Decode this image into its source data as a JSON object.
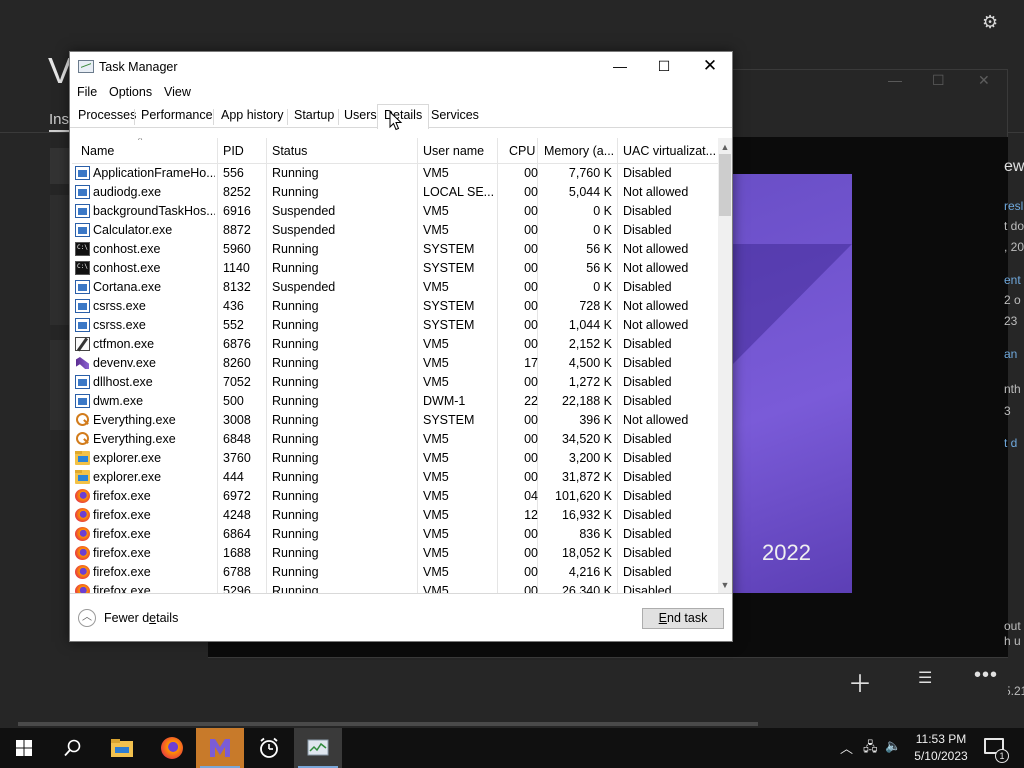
{
  "background_app": {
    "title_fragment": "V",
    "tab_fragment": "Ins",
    "year": "2022",
    "side_texts": [
      "ew",
      "resl",
      "t do",
      ", 20",
      "ent",
      "2 o",
      "23",
      "an",
      "nth",
      "3",
      "t d",
      "out",
      "h u",
      "5.21"
    ]
  },
  "task_manager": {
    "title": "Task Manager",
    "menu": [
      "File",
      "Options",
      "View"
    ],
    "tabs": [
      "Processes",
      "Performance",
      "App history",
      "Startup",
      "Users",
      "Details",
      "Services"
    ],
    "active_tab": "Details",
    "columns": [
      "Name",
      "PID",
      "Status",
      "User name",
      "CPU",
      "Memory (a...",
      "UAC virtualizat..."
    ],
    "rows": [
      {
        "icon": "app-icon",
        "name": "ApplicationFrameHo...",
        "pid": "556",
        "status": "Running",
        "user": "VM5",
        "cpu": "00",
        "mem": "7,760 K",
        "uac": "Disabled"
      },
      {
        "icon": "app-icon",
        "name": "audiodg.exe",
        "pid": "8252",
        "status": "Running",
        "user": "LOCAL SE...",
        "cpu": "00",
        "mem": "5,044 K",
        "uac": "Not allowed"
      },
      {
        "icon": "app-icon",
        "name": "backgroundTaskHos...",
        "pid": "6916",
        "status": "Suspended",
        "user": "VM5",
        "cpu": "00",
        "mem": "0 K",
        "uac": "Disabled"
      },
      {
        "icon": "app-icon",
        "name": "Calculator.exe",
        "pid": "8872",
        "status": "Suspended",
        "user": "VM5",
        "cpu": "00",
        "mem": "0 K",
        "uac": "Disabled"
      },
      {
        "icon": "console-icon",
        "name": "conhost.exe",
        "pid": "5960",
        "status": "Running",
        "user": "SYSTEM",
        "cpu": "00",
        "mem": "56 K",
        "uac": "Not allowed"
      },
      {
        "icon": "console-icon",
        "name": "conhost.exe",
        "pid": "1140",
        "status": "Running",
        "user": "SYSTEM",
        "cpu": "00",
        "mem": "56 K",
        "uac": "Not allowed"
      },
      {
        "icon": "app-icon",
        "name": "Cortana.exe",
        "pid": "8132",
        "status": "Suspended",
        "user": "VM5",
        "cpu": "00",
        "mem": "0 K",
        "uac": "Disabled"
      },
      {
        "icon": "app-icon",
        "name": "csrss.exe",
        "pid": "436",
        "status": "Running",
        "user": "SYSTEM",
        "cpu": "00",
        "mem": "728 K",
        "uac": "Not allowed"
      },
      {
        "icon": "app-icon",
        "name": "csrss.exe",
        "pid": "552",
        "status": "Running",
        "user": "SYSTEM",
        "cpu": "00",
        "mem": "1,044 K",
        "uac": "Not allowed"
      },
      {
        "icon": "ctfmon-icon",
        "name": "ctfmon.exe",
        "pid": "6876",
        "status": "Running",
        "user": "VM5",
        "cpu": "00",
        "mem": "2,152 K",
        "uac": "Disabled"
      },
      {
        "icon": "visual-studio-icon",
        "name": "devenv.exe",
        "pid": "8260",
        "status": "Running",
        "user": "VM5",
        "cpu": "17",
        "mem": "4,500 K",
        "uac": "Disabled"
      },
      {
        "icon": "app-icon",
        "name": "dllhost.exe",
        "pid": "7052",
        "status": "Running",
        "user": "VM5",
        "cpu": "00",
        "mem": "1,272 K",
        "uac": "Disabled"
      },
      {
        "icon": "app-icon",
        "name": "dwm.exe",
        "pid": "500",
        "status": "Running",
        "user": "DWM-1",
        "cpu": "22",
        "mem": "22,188 K",
        "uac": "Disabled"
      },
      {
        "icon": "everything-search-icon",
        "name": "Everything.exe",
        "pid": "3008",
        "status": "Running",
        "user": "SYSTEM",
        "cpu": "00",
        "mem": "396 K",
        "uac": "Not allowed"
      },
      {
        "icon": "everything-search-icon",
        "name": "Everything.exe",
        "pid": "6848",
        "status": "Running",
        "user": "VM5",
        "cpu": "00",
        "mem": "34,520 K",
        "uac": "Disabled"
      },
      {
        "icon": "explorer-folder-icon",
        "name": "explorer.exe",
        "pid": "3760",
        "status": "Running",
        "user": "VM5",
        "cpu": "00",
        "mem": "3,200 K",
        "uac": "Disabled"
      },
      {
        "icon": "explorer-folder-icon",
        "name": "explorer.exe",
        "pid": "444",
        "status": "Running",
        "user": "VM5",
        "cpu": "00",
        "mem": "31,872 K",
        "uac": "Disabled"
      },
      {
        "icon": "firefox-icon",
        "name": "firefox.exe",
        "pid": "6972",
        "status": "Running",
        "user": "VM5",
        "cpu": "04",
        "mem": "101,620 K",
        "uac": "Disabled"
      },
      {
        "icon": "firefox-icon",
        "name": "firefox.exe",
        "pid": "4248",
        "status": "Running",
        "user": "VM5",
        "cpu": "12",
        "mem": "16,932 K",
        "uac": "Disabled"
      },
      {
        "icon": "firefox-icon",
        "name": "firefox.exe",
        "pid": "6864",
        "status": "Running",
        "user": "VM5",
        "cpu": "00",
        "mem": "836 K",
        "uac": "Disabled"
      },
      {
        "icon": "firefox-icon",
        "name": "firefox.exe",
        "pid": "1688",
        "status": "Running",
        "user": "VM5",
        "cpu": "00",
        "mem": "18,052 K",
        "uac": "Disabled"
      },
      {
        "icon": "firefox-icon",
        "name": "firefox.exe",
        "pid": "6788",
        "status": "Running",
        "user": "VM5",
        "cpu": "00",
        "mem": "4,216 K",
        "uac": "Disabled"
      },
      {
        "icon": "firefox-icon",
        "name": "firefox.exe",
        "pid": "5296",
        "status": "Running",
        "user": "VM5",
        "cpu": "00",
        "mem": "26,340 K",
        "uac": "Disabled"
      }
    ],
    "footer": {
      "fewer_details": "Fewer details",
      "end_task": "End task"
    }
  },
  "taskbar": {
    "apps": [
      "start-icon",
      "search-icon",
      "file-explorer-icon",
      "firefox-icon",
      "visual-studio-installer-icon",
      "alarms-clock-icon",
      "task-manager-icon"
    ],
    "clock_time": "11:53 PM",
    "clock_date": "5/10/2023",
    "notification_count": "1"
  }
}
